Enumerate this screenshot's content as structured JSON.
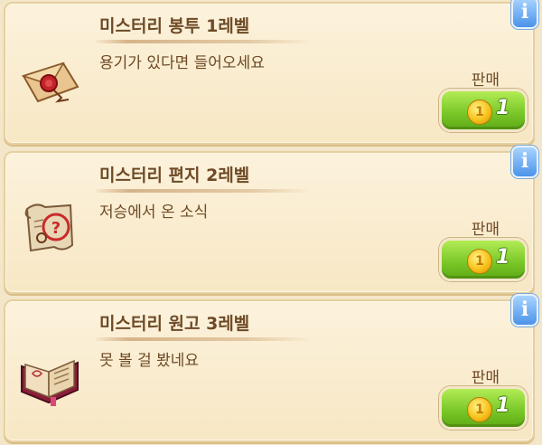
{
  "items": [
    {
      "title": "미스터리 봉투 1레벨",
      "description": "용기가 있다면 들어오세요",
      "price_label": "판매",
      "price": "1",
      "icon": "mystery-envelope-icon"
    },
    {
      "title": "미스터리 편지 2레벨",
      "description": "저승에서 온 소식",
      "price_label": "판매",
      "price": "1",
      "icon": "mystery-letter-icon"
    },
    {
      "title": "미스터리 원고 3레벨",
      "description": "못 볼 걸 봤네요",
      "price_label": "판매",
      "price": "1",
      "icon": "mystery-manuscript-icon"
    }
  ],
  "info_label": "i",
  "coin_label": "1",
  "colors": {
    "text": "#6e4a26",
    "button_green": "#7cc92a",
    "info_blue": "#4b93e8",
    "card_bg": "#fcf2dc"
  }
}
